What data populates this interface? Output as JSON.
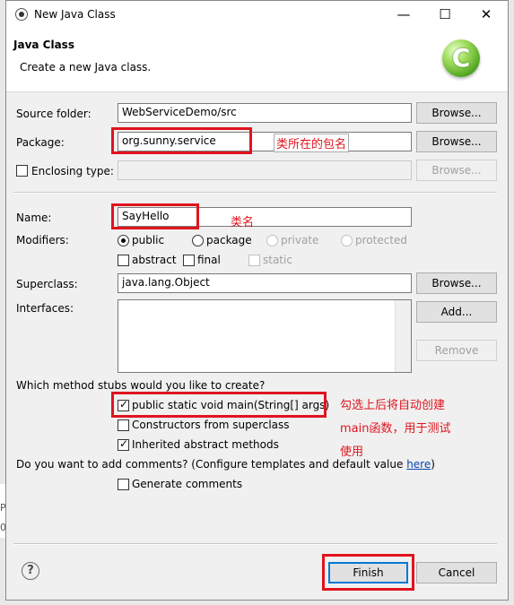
{
  "window": {
    "title": "New Java Class",
    "minimize": "—",
    "maximize": "☐",
    "close": "✕"
  },
  "header": {
    "title": "Java Class",
    "description": "Create a new Java class.",
    "logo_letter": "C"
  },
  "background": {
    "fragments": [
      "Pr",
      "0"
    ]
  },
  "form": {
    "source_folder": {
      "label": "Source folder:",
      "value": "WebServiceDemo/src",
      "browse": "Browse..."
    },
    "package": {
      "label": "Package:",
      "value": "org.sunny.service",
      "browse": "Browse..."
    },
    "enclosing_type": {
      "label": "Enclosing type:",
      "value": "",
      "checked": false,
      "browse": "Browse..."
    },
    "name": {
      "label": "Name:",
      "value": "SayHello"
    },
    "modifiers": {
      "label": "Modifiers:",
      "access": [
        {
          "label": "public",
          "selected": true,
          "enabled": true
        },
        {
          "label": "package",
          "selected": false,
          "enabled": true
        },
        {
          "label": "private",
          "selected": false,
          "enabled": false
        },
        {
          "label": "protected",
          "selected": false,
          "enabled": false
        }
      ],
      "flags": [
        {
          "label": "abstract",
          "checked": false,
          "enabled": true
        },
        {
          "label": "final",
          "checked": false,
          "enabled": true
        },
        {
          "label": "static",
          "checked": false,
          "enabled": false
        }
      ]
    },
    "superclass": {
      "label": "Superclass:",
      "value": "java.lang.Object",
      "browse": "Browse..."
    },
    "interfaces": {
      "label": "Interfaces:",
      "add": "Add...",
      "remove": "Remove"
    },
    "stubs": {
      "question": "Which method stubs would you like to create?",
      "options": [
        {
          "label": "public static void main(String[] args)",
          "checked": true
        },
        {
          "label": "Constructors from superclass",
          "checked": false
        },
        {
          "label": "Inherited abstract methods",
          "checked": true
        }
      ]
    },
    "comments": {
      "question": "Do you want to add comments? (Configure templates and default value ",
      "link": "here",
      "question_end": ")",
      "generate": {
        "label": "Generate comments",
        "checked": false
      }
    }
  },
  "annotations": {
    "package_note": "类所在的包名",
    "name_note": "类名",
    "main_note_lines": [
      "勾选上后将自动创建",
      "main函数，用于测试",
      "使用"
    ]
  },
  "footer": {
    "help": "?",
    "finish": "Finish",
    "cancel": "Cancel"
  },
  "colors": {
    "annotation_red": "#e0141e",
    "default_button_border": "#0078d7",
    "logo_green": "#4ea320"
  }
}
